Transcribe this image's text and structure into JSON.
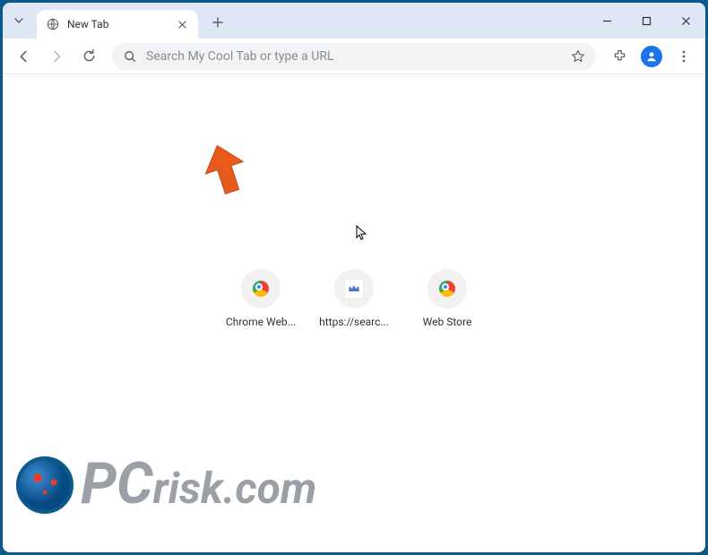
{
  "tab": {
    "title": "New Tab"
  },
  "omnibox": {
    "placeholder": "Search My Cool Tab or type a URL"
  },
  "shortcuts": [
    {
      "label": "Chrome Web...",
      "icon": "chrome"
    },
    {
      "label": "https://searc...",
      "icon": "searchsite"
    },
    {
      "label": "Web Store",
      "icon": "chrome"
    }
  ],
  "watermark": {
    "text_prefix": "PC",
    "text_suffix": "risk.com"
  },
  "colors": {
    "frame_blue": "#0a5a8a",
    "tabstrip": "#dde7f5",
    "arrow_orange": "#e85a1a",
    "avatar_blue": "#1a73e8",
    "watermark_gray": "#9aa0a6"
  }
}
